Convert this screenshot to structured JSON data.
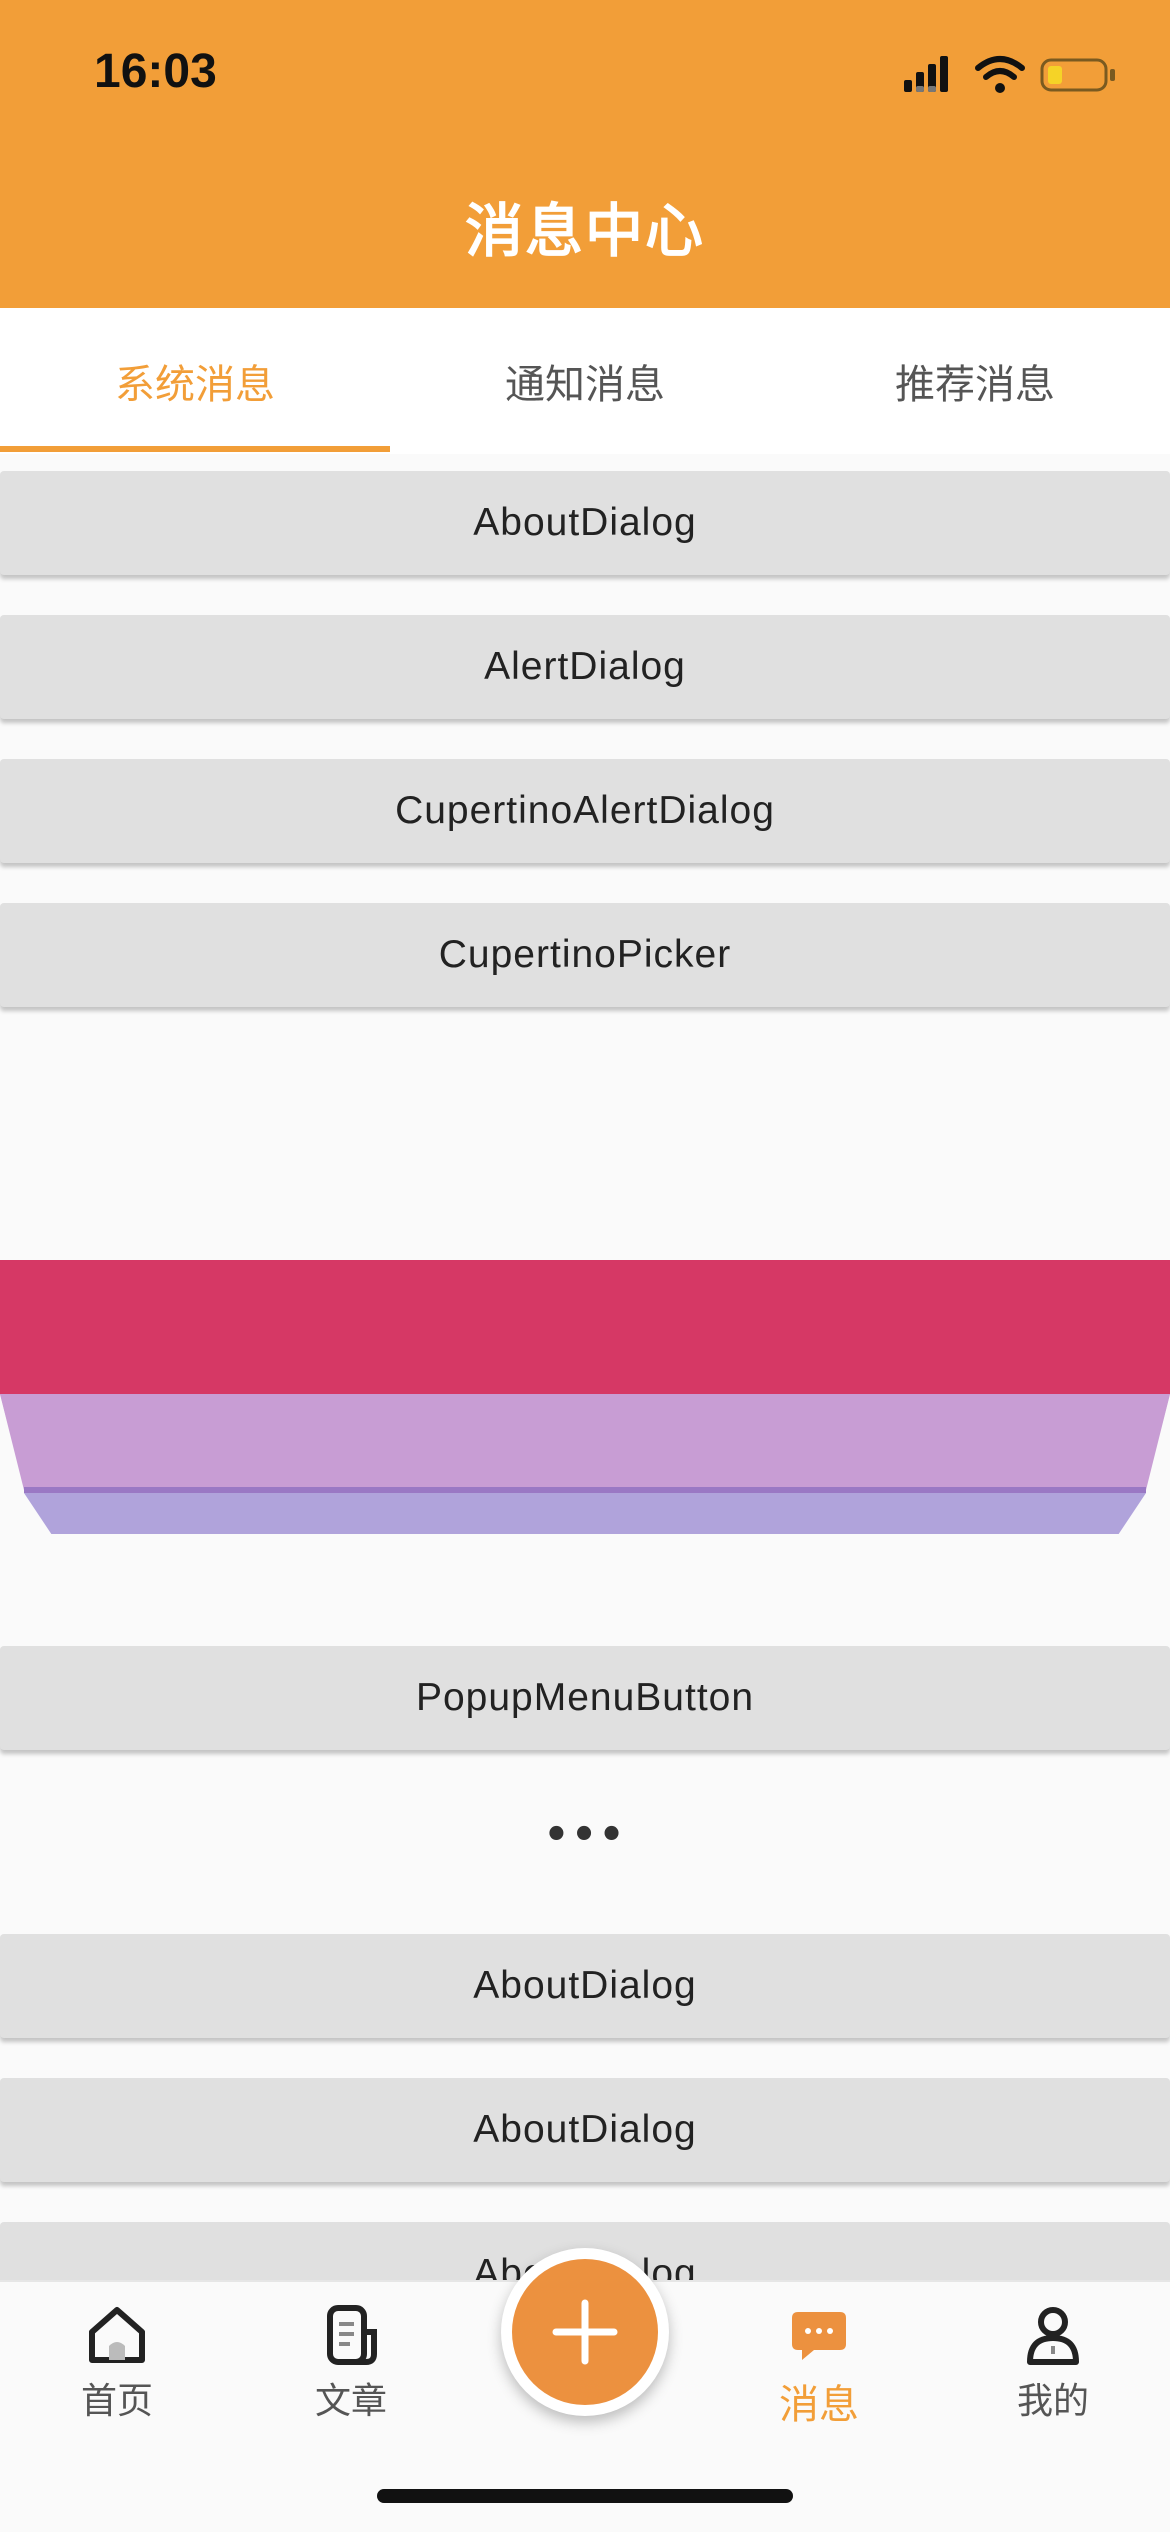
{
  "status_bar": {
    "time": "16:03"
  },
  "header": {
    "title": "消息中心"
  },
  "tabs": [
    {
      "label": "系统消息",
      "active": true
    },
    {
      "label": "通知消息",
      "active": false
    },
    {
      "label": "推荐消息",
      "active": false
    }
  ],
  "list": {
    "buttons_top": [
      {
        "label": "AboutDialog"
      },
      {
        "label": "AlertDialog"
      },
      {
        "label": "CupertinoAlertDialog"
      },
      {
        "label": "CupertinoPicker"
      }
    ],
    "picker_colors": {
      "selected": "#d63865",
      "band_1": "#c89dd4",
      "band_2": "#b0a3db",
      "separator": "#9a78c4"
    },
    "popup_button": {
      "label": "PopupMenuButton"
    },
    "ellipsis": "•••",
    "buttons_bottom": [
      {
        "label": "AboutDialog"
      },
      {
        "label": "AboutDialog"
      },
      {
        "label": "AboutDialog"
      }
    ]
  },
  "bottom_nav": {
    "items": [
      {
        "label": "首页",
        "icon": "home-icon",
        "active": false
      },
      {
        "label": "文章",
        "icon": "article-icon",
        "active": false
      },
      {
        "label": "消息",
        "icon": "message-icon",
        "active": true
      },
      {
        "label": "我的",
        "icon": "profile-icon",
        "active": false
      }
    ],
    "fab_icon": "plus-icon"
  },
  "colors": {
    "primary": "#f29e38",
    "tab_active": "#f29e38",
    "button_bg": "#e0e0e0"
  }
}
